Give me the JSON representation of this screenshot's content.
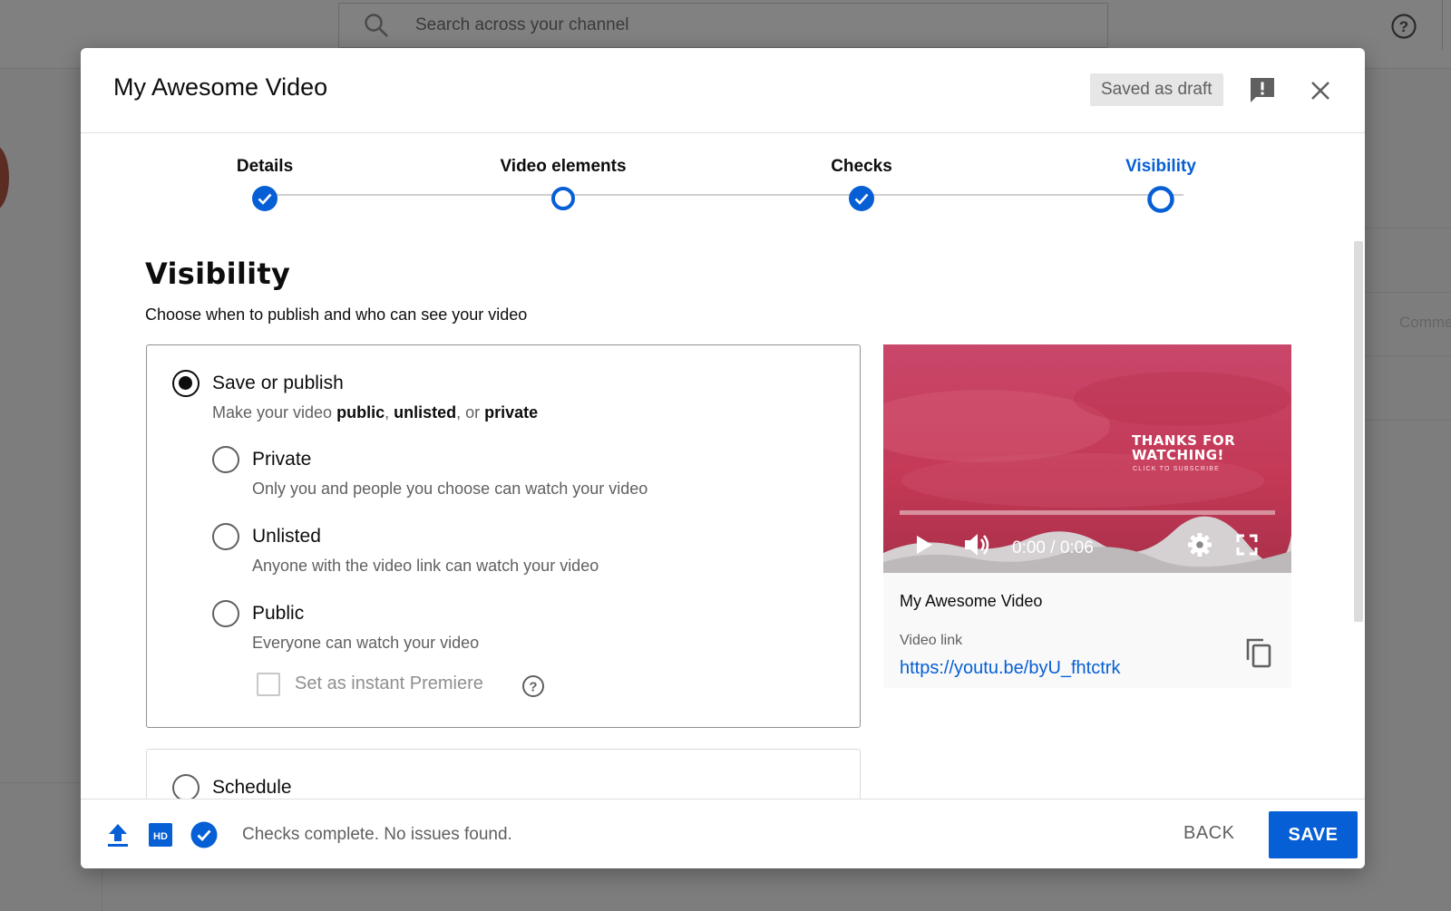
{
  "background": {
    "search_placeholder": "Search across your channel",
    "right_partial_text": "Comme"
  },
  "modal": {
    "title": "My Awesome Video",
    "draft_status": "Saved as draft"
  },
  "stepper": {
    "steps": [
      {
        "label": "Details",
        "state": "done"
      },
      {
        "label": "Video elements",
        "state": "pending"
      },
      {
        "label": "Checks",
        "state": "done"
      },
      {
        "label": "Visibility",
        "state": "active"
      }
    ]
  },
  "visibility": {
    "heading": "Visibility",
    "subheading": "Choose when to publish and who can see your video",
    "save_or_publish": {
      "title": "Save or publish",
      "desc_prefix": "Make your video ",
      "desc_public": "public",
      "desc_sep1": ", ",
      "desc_unlisted": "unlisted",
      "desc_sep2": ", or ",
      "desc_private": "private",
      "selected": true
    },
    "options": [
      {
        "title": "Private",
        "desc": "Only you and people you choose can watch your video"
      },
      {
        "title": "Unlisted",
        "desc": "Anyone with the video link can watch your video"
      },
      {
        "title": "Public",
        "desc": "Everyone can watch your video"
      }
    ],
    "premiere_label": "Set as instant Premiere",
    "schedule_title": "Schedule"
  },
  "preview": {
    "overlay_line1": "THANKS FOR",
    "overlay_line2": "WATCHING!",
    "overlay_small": "CLICK TO SUBSCRIBE",
    "time": "0:00 / 0:06",
    "title": "My Awesome Video",
    "link_label": "Video link",
    "link_url": "https://youtu.be/byU_fhtctrk"
  },
  "footer": {
    "status": "Checks complete. No issues found.",
    "back_label": "BACK",
    "save_label": "SAVE"
  },
  "colors": {
    "accent": "#065fd4",
    "overlay": "#7d7d7d"
  }
}
